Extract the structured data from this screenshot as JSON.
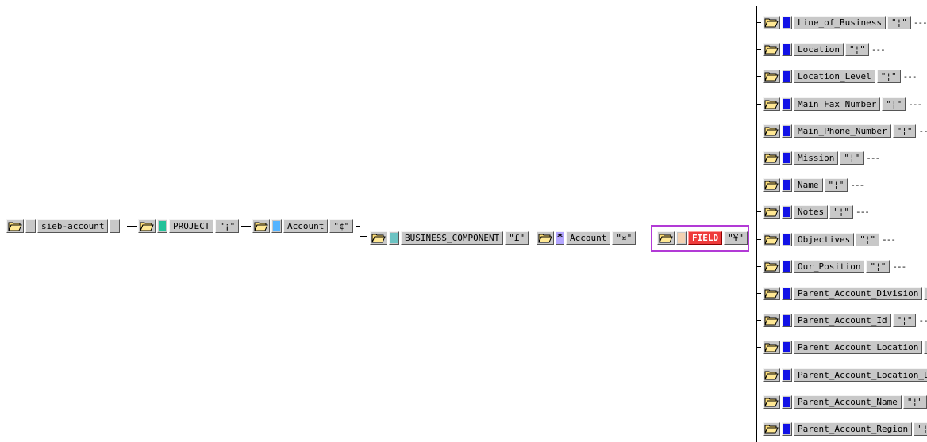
{
  "colors": {
    "node_bg": "#c8c8c8",
    "swatch_project": "#22c29a",
    "swatch_account": "#55b4ff",
    "swatch_bc": "#6cc3c3",
    "swatch_field": "#f3d1b1",
    "field_label_bg": "#ee3b3b",
    "star_bg": "#b3a6ff",
    "field_swatch": "#1212e6",
    "selection": "#b23ad6"
  },
  "root": {
    "label": "sieb-account"
  },
  "project": {
    "label": "PROJECT",
    "sep": "\"¡\""
  },
  "account": {
    "label": "Account",
    "sep": "\"¢\""
  },
  "business_component": {
    "label": "BUSINESS_COMPONENT",
    "sep": "\"£\""
  },
  "bc_account": {
    "star": "*",
    "label": "Account",
    "sep": "\"¤\""
  },
  "field": {
    "label": "FIELD",
    "sep": "\"¥\""
  },
  "fields": [
    {
      "label": "Line_of_Business",
      "sep": "\"¦\"",
      "dots": "---"
    },
    {
      "label": "Location",
      "sep": "\"¦\"",
      "dots": "---"
    },
    {
      "label": "Location_Level",
      "sep": "\"¦\"",
      "dots": "---"
    },
    {
      "label": "Main_Fax_Number",
      "sep": "\"¦\"",
      "dots": "---"
    },
    {
      "label": "Main_Phone_Number",
      "sep": "\"¦\"",
      "dots": "---"
    },
    {
      "label": "Mission",
      "sep": "\"¦\"",
      "dots": "---"
    },
    {
      "label": "Name",
      "sep": "\"¦\"",
      "dots": "---"
    },
    {
      "label": "Notes",
      "sep": "\"¦\"",
      "dots": "---"
    },
    {
      "label": "Objectives",
      "sep": "\"¦\"",
      "dots": "---"
    },
    {
      "label": "Our_Position",
      "sep": "\"¦\"",
      "dots": "---"
    },
    {
      "label": "Parent_Account_Division",
      "sep": "\"",
      "dots": ""
    },
    {
      "label": "Parent_Account_Id",
      "sep": "\"¦\"",
      "dots": "---"
    },
    {
      "label": "Parent_Account_Location",
      "sep": "\"",
      "dots": ""
    },
    {
      "label": "Parent_Account_Location_Le",
      "sep": "",
      "dots": ""
    },
    {
      "label": "Parent_Account_Name",
      "sep": "\"¦\"",
      "dots": "-"
    },
    {
      "label": "Parent_Account_Region",
      "sep": "\"¦",
      "dots": ""
    }
  ]
}
